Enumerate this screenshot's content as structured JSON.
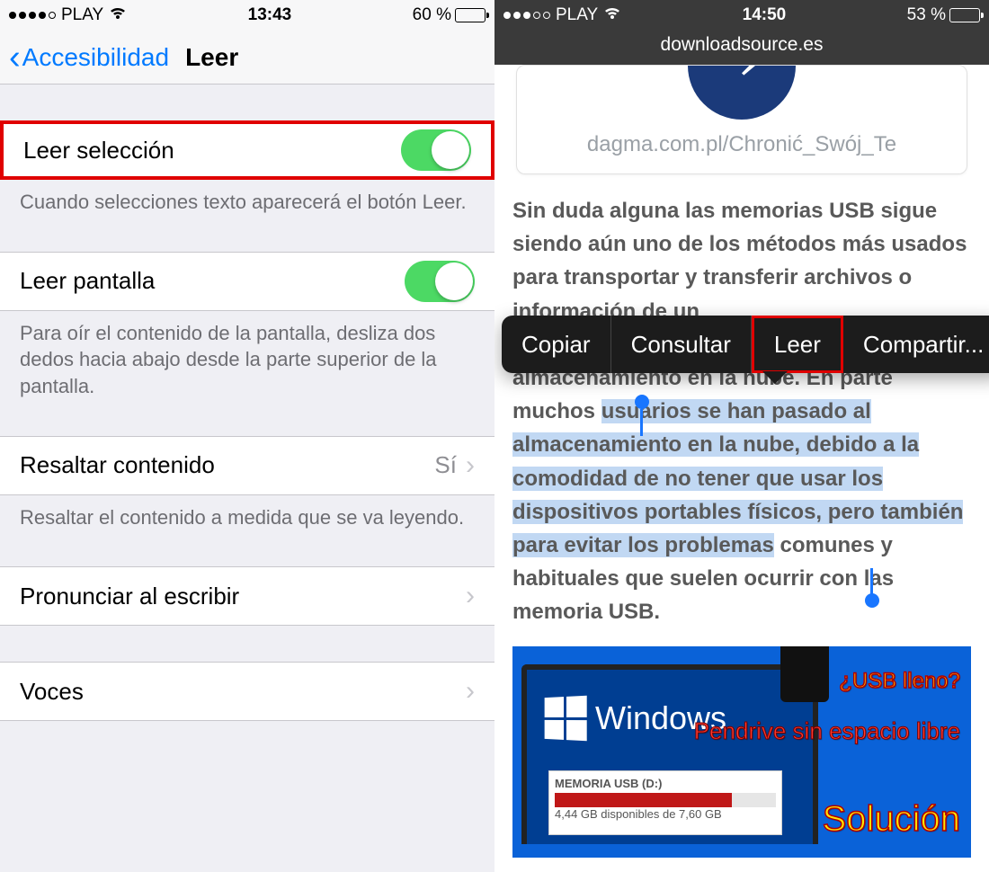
{
  "left": {
    "status": {
      "carrier": "PLAY",
      "time": "13:43",
      "battery_pct": "60 %",
      "battery_fill": "60%"
    },
    "nav": {
      "back": "Accesibilidad",
      "title": "Leer"
    },
    "rows": {
      "read_selection": {
        "label": "Leer selección"
      },
      "read_selection_footer": "Cuando selecciones texto aparecerá el botón Leer.",
      "read_screen": {
        "label": "Leer pantalla"
      },
      "read_screen_footer": "Para oír el contenido de la pantalla, desliza dos dedos hacia abajo desde la parte superior de la pantalla.",
      "highlight": {
        "label": "Resaltar contenido",
        "value": "Sí"
      },
      "highlight_footer": "Resaltar el contenido a medida que se va leyendo.",
      "typing": {
        "label": "Pronunciar al escribir"
      },
      "voices": {
        "label": "Voces"
      }
    }
  },
  "right": {
    "status": {
      "carrier": "PLAY",
      "time": "14:50",
      "battery_pct": "53 %",
      "battery_fill": "53%"
    },
    "url": "downloadsource.es",
    "ad_url": "dagma.com.pl/Chronić_Swój_Te",
    "article": {
      "pre": "Sin duda alguna las memorias USB sigue siendo aún uno de los métodos más usados para transportar y transferir archivos o información de un",
      "between": "almacenamiento en la nube. En parte muchos ",
      "sel": "usuarios se han pasado al almacenamiento en la nube, debido a la comodidad de no tener que usar los dispositivos portables físicos, pero también para evitar los problemas",
      "post": " comunes y habituales que suelen ocurrir con las memoria USB."
    },
    "menu": {
      "copy": "Copiar",
      "lookup": "Consultar",
      "read": "Leer",
      "share": "Compartir..."
    },
    "promo": {
      "usb_full": "¿USB lleno?",
      "pendrive": "Pendrive sin espacio libre",
      "solution": "Solución",
      "windows": "Windows",
      "disk_name": "MEMORIA USB (D:)",
      "disk_free": "4,44 GB disponibles de 7,60 GB"
    }
  }
}
